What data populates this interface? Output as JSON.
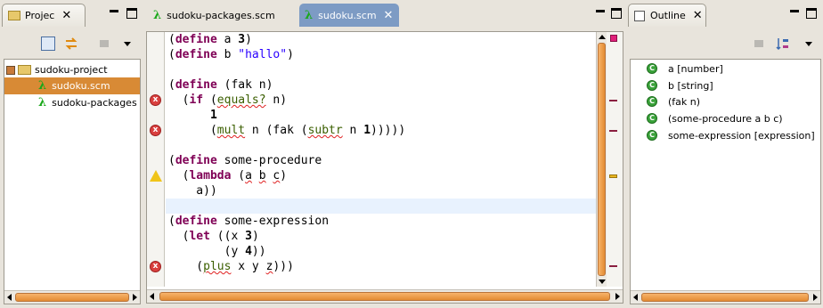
{
  "project_pane": {
    "tab_label": "Projec",
    "tree": [
      {
        "label": "sudoku-project"
      },
      {
        "label": "sudoku.scm"
      },
      {
        "label": "sudoku-packages"
      }
    ]
  },
  "editor": {
    "tabs": [
      {
        "label": "sudoku-packages.scm"
      },
      {
        "label": "sudoku.scm"
      }
    ]
  },
  "outline_pane": {
    "tab_label": "Outline",
    "items": [
      {
        "label": "a [number]"
      },
      {
        "label": "b [string]"
      },
      {
        "label": "(fak n)"
      },
      {
        "label": "(some-procedure a b c)"
      },
      {
        "label": "some-expression [expression]"
      }
    ]
  },
  "icons": {
    "close": "close-icon",
    "lambda_glyph": "λ",
    "error_glyph": "x",
    "outline_glyph": "C"
  },
  "colors": {
    "selection": "#d88a35",
    "keyword": "#7f0055",
    "string": "#2a00ff",
    "error": "#d9403f",
    "warning": "#f0c419",
    "current_line": "#e8f2fe"
  }
}
